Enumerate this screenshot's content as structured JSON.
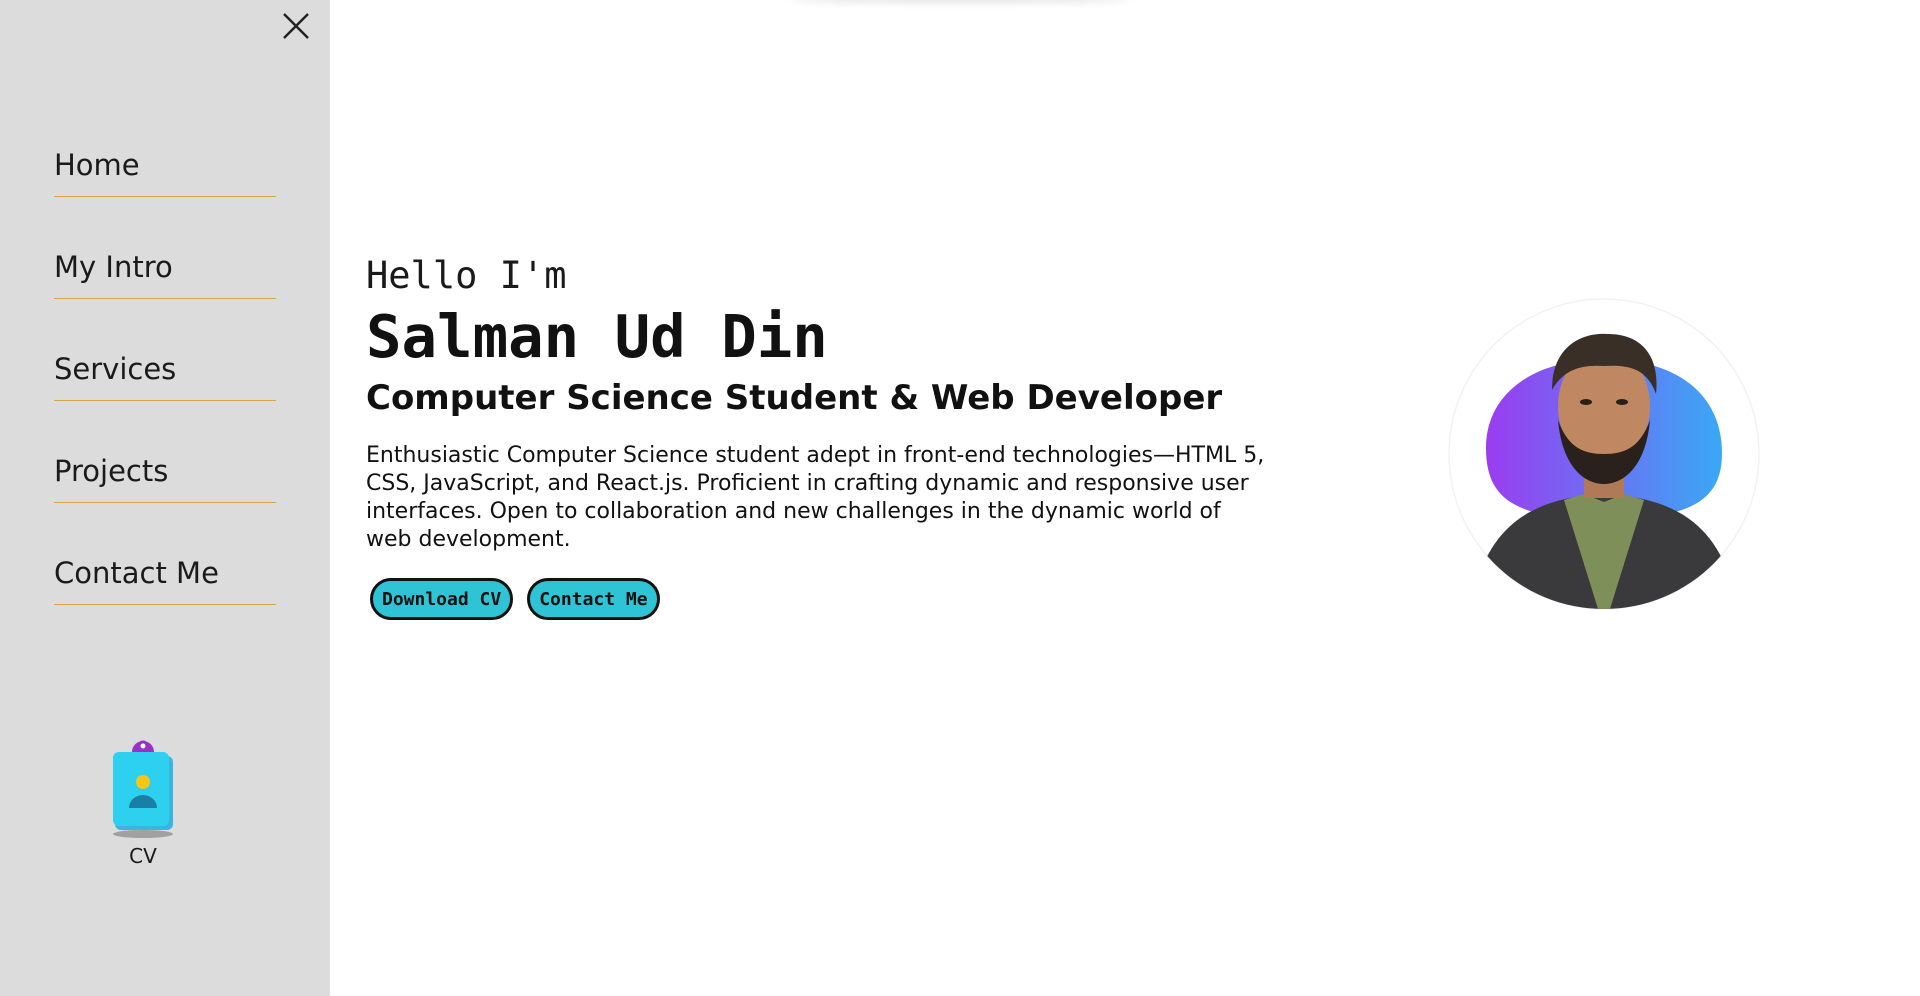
{
  "sidebar": {
    "items": [
      {
        "label": "Home"
      },
      {
        "label": "My Intro"
      },
      {
        "label": "Services"
      },
      {
        "label": "Projects"
      },
      {
        "label": "Contact Me"
      }
    ],
    "cv_label": "CV",
    "close_icon": "close-icon",
    "cv_icon": "id-badge-icon"
  },
  "hero": {
    "greeting": "Hello I'm",
    "name": "Salman Ud Din",
    "role": "Computer Science Student & Web Developer",
    "bio": "Enthusiastic Computer Science student adept in front-end technologies—HTML 5, CSS, JavaScript, and React.js. Proficient in crafting dynamic and responsive user interfaces. Open to collaboration and new challenges in the dynamic world of web development.",
    "buttons": {
      "download_cv": "Download CV",
      "contact_me": "Contact Me"
    }
  },
  "colors": {
    "sidebar_bg": "#dcdcdc",
    "nav_underline": "#d9a54a",
    "button_bg": "#2ec4d6",
    "blob_start": "#9b3cf0",
    "blob_end": "#3aa8f5"
  }
}
